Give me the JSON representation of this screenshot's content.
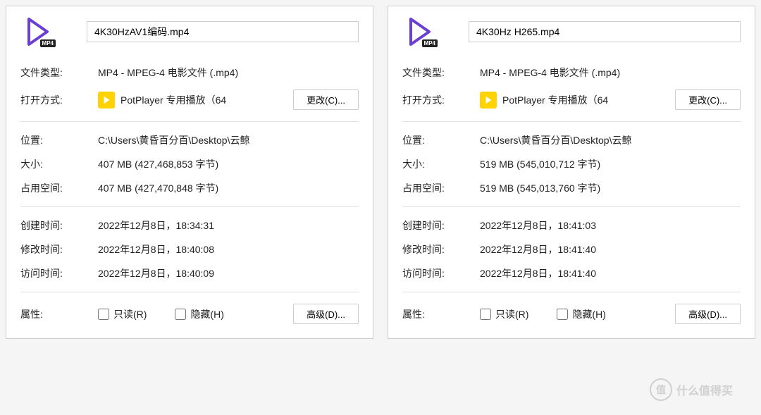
{
  "panels": [
    {
      "filename": "4K30HzAV1编码.mp4",
      "labels": {
        "file_type": "文件类型:",
        "open_with": "打开方式:",
        "location": "位置:",
        "size": "大小:",
        "size_on_disk": "占用空间:",
        "created": "创建时间:",
        "modified": "修改时间:",
        "accessed": "访问时间:",
        "attributes": "属性:"
      },
      "file_type": "MP4 - MPEG-4 电影文件 (.mp4)",
      "app_name": "PotPlayer 专用播放（64",
      "change_btn": "更改(C)...",
      "location": "C:\\Users\\黄昏百分百\\Desktop\\云鲸",
      "size": "407 MB (427,468,853 字节)",
      "size_on_disk": "407 MB (427,470,848 字节)",
      "created": "2022年12月8日，18:34:31",
      "modified": "2022年12月8日，18:40:08",
      "accessed": "2022年12月8日，18:40:09",
      "readonly_label": "只读(R)",
      "hidden_label": "隐藏(H)",
      "advanced_btn": "高级(D)..."
    },
    {
      "filename": "4K30Hz H265.mp4",
      "labels": {
        "file_type": "文件类型:",
        "open_with": "打开方式:",
        "location": "位置:",
        "size": "大小:",
        "size_on_disk": "占用空间:",
        "created": "创建时间:",
        "modified": "修改时间:",
        "accessed": "访问时间:",
        "attributes": "属性:"
      },
      "file_type": "MP4 - MPEG-4 电影文件 (.mp4)",
      "app_name": "PotPlayer 专用播放（64",
      "change_btn": "更改(C)...",
      "location": "C:\\Users\\黄昏百分百\\Desktop\\云鲸",
      "size": "519 MB (545,010,712 字节)",
      "size_on_disk": "519 MB (545,013,760 字节)",
      "created": "2022年12月8日，18:41:03",
      "modified": "2022年12月8日，18:41:40",
      "accessed": "2022年12月8日，18:41:40",
      "readonly_label": "只读(R)",
      "hidden_label": "隐藏(H)",
      "advanced_btn": "高级(D)..."
    }
  ],
  "watermark": {
    "circle": "值",
    "text": "什么值得买"
  }
}
